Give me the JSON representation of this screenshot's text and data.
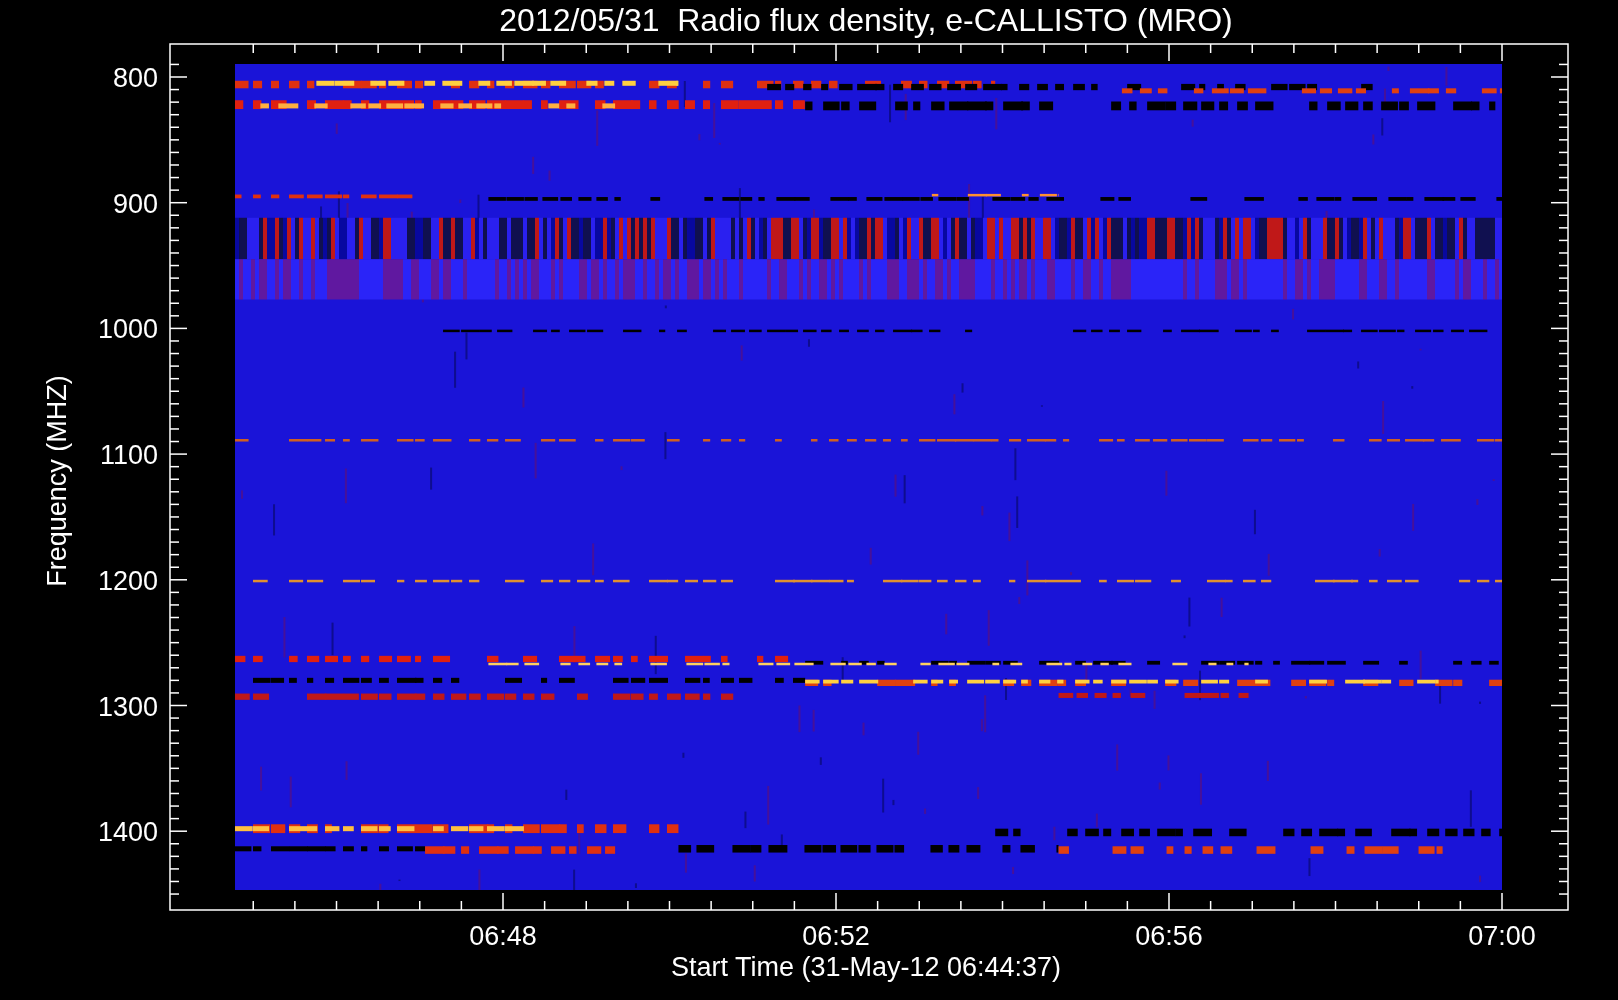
{
  "title": "2012/05/31  Radio flux density, e-CALLISTO (MRO)",
  "plot": {
    "ylabel": "Frequency (MHZ)",
    "xlabel": "Start Time (31-May-12 06:44:37)",
    "yticks": [
      "800",
      "900",
      "1000",
      "1100",
      "1200",
      "1300",
      "1400"
    ],
    "xticks": [
      "06:48",
      "06:52",
      "06:56",
      "07:00"
    ]
  }
}
